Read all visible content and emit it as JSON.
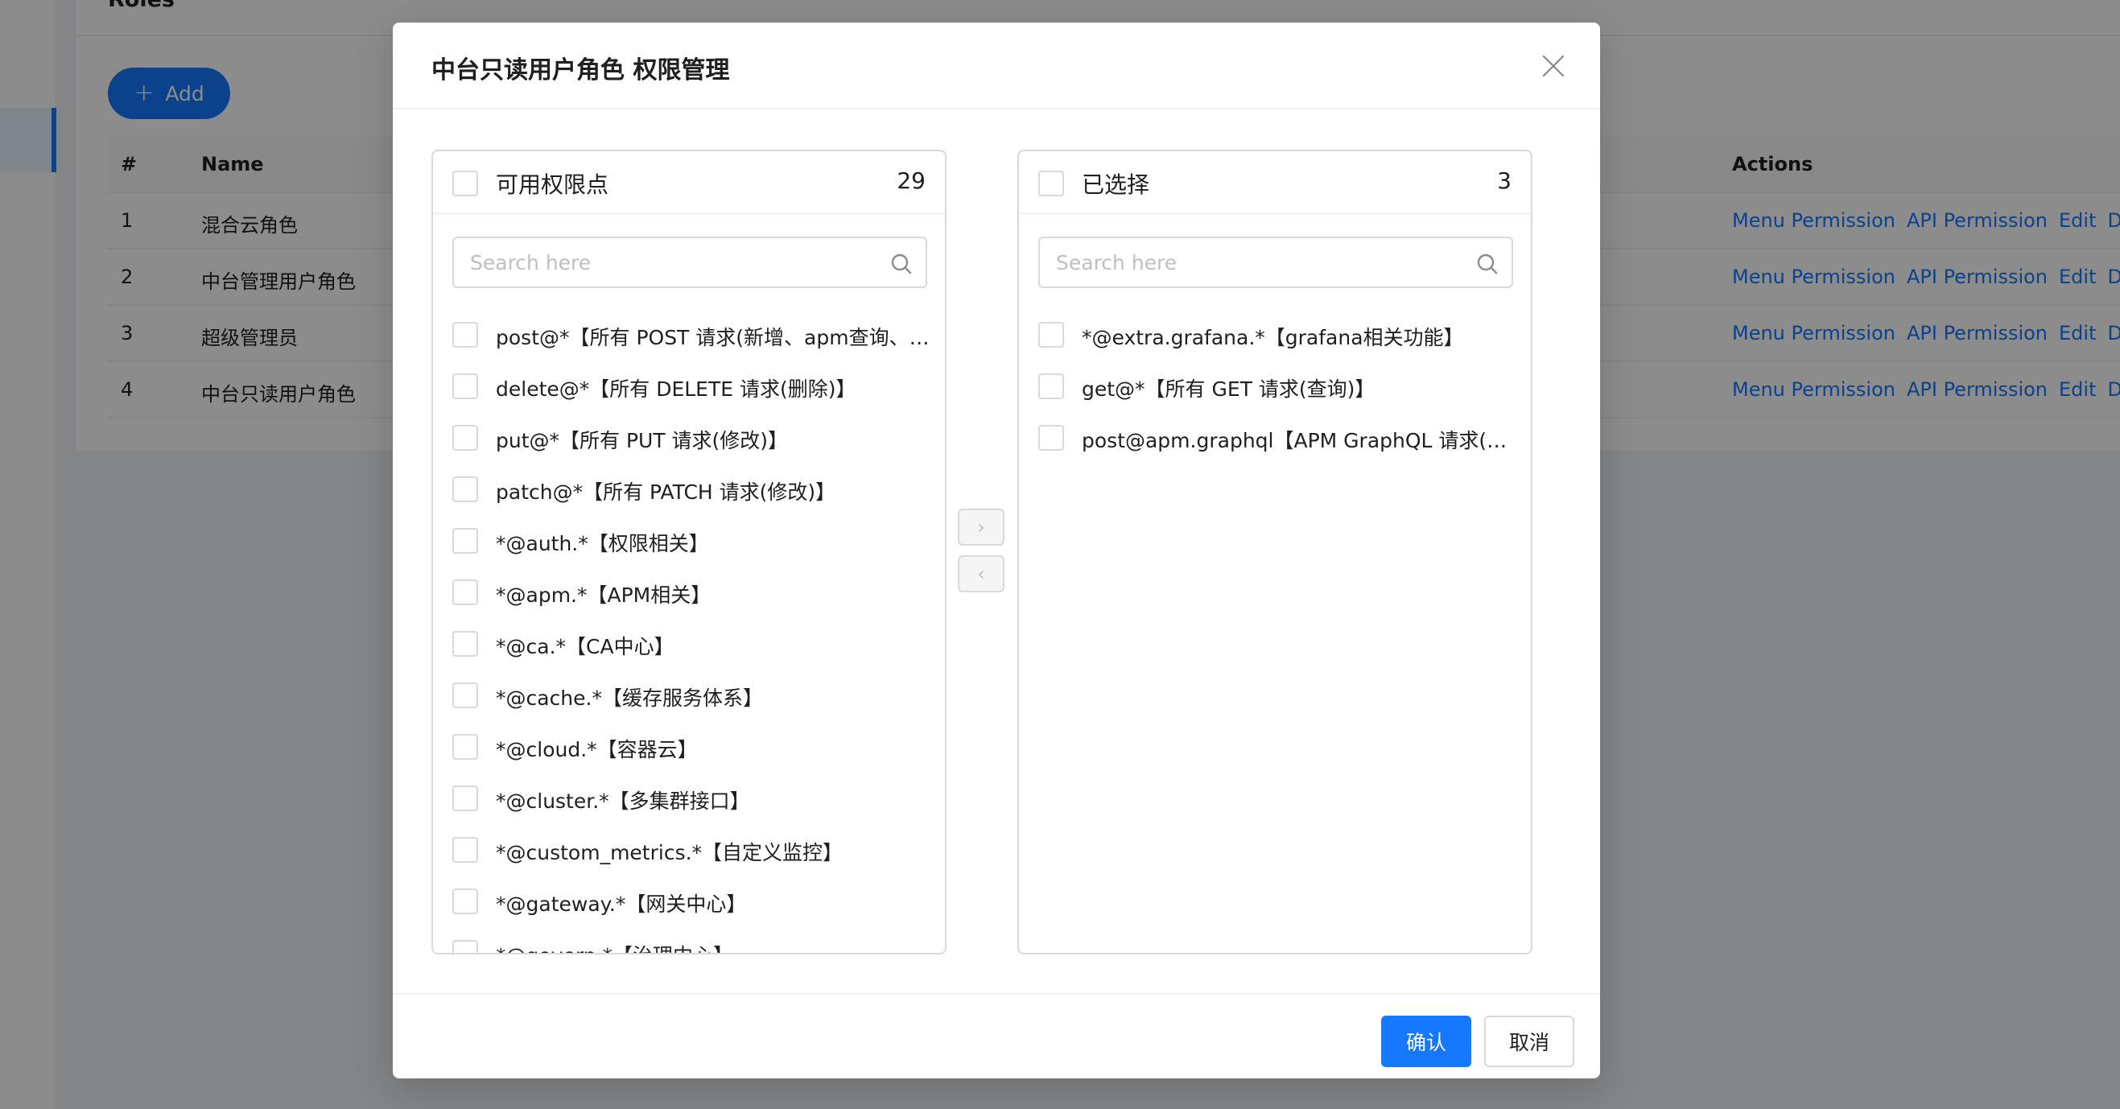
{
  "page": {
    "section_title": "Roles",
    "add_button_label": "Add",
    "table": {
      "columns": [
        "#",
        "Name",
        "Actions"
      ],
      "rows": [
        {
          "index": "1",
          "name": "混合云角色"
        },
        {
          "index": "2",
          "name": "中台管理用户角色"
        },
        {
          "index": "3",
          "name": "超级管理员"
        },
        {
          "index": "4",
          "name": "中台只读用户角色"
        }
      ],
      "actions": [
        "Menu Permission",
        "API Permission",
        "Edit",
        "Delete"
      ]
    }
  },
  "modal": {
    "title": "中台只读用户角色 权限管理",
    "left_panel": {
      "title": "可用权限点",
      "count": "29",
      "search_placeholder": "Search here",
      "items": [
        "post@*【所有 POST 请求(新增、apm查询、部署等)】",
        "delete@*【所有 DELETE 请求(删除)】",
        "put@*【所有 PUT 请求(修改)】",
        "patch@*【所有 PATCH 请求(修改)】",
        "*@auth.*【权限相关】",
        "*@apm.*【APM相关】",
        "*@ca.*【CA中心】",
        "*@cache.*【缓存服务体系】",
        "*@cloud.*【容器云】",
        "*@cluster.*【多集群接口】",
        "*@custom_metrics.*【自定义监控】",
        "*@gateway.*【网关中心】",
        "*@govern.*【治理中心】"
      ]
    },
    "right_panel": {
      "title": "已选择",
      "count": "3",
      "search_placeholder": "Search here",
      "items": [
        "*@extra.grafana.*【grafana相关功能】",
        "get@*【所有 GET 请求(查询)】",
        "post@apm.graphql【APM GraphQL 请求(修改、查询)】"
      ]
    },
    "transfer_right_icon": "chevron-right-icon",
    "transfer_left_icon": "chevron-left-icon",
    "confirm_label": "确认",
    "cancel_label": "取消"
  }
}
